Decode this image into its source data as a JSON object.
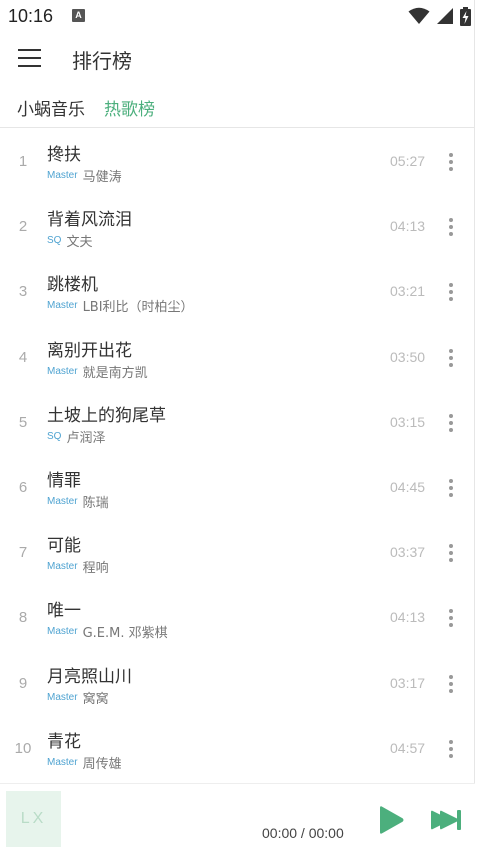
{
  "status_bar": {
    "time": "10:16",
    "notification_badge": "A",
    "icons": [
      "wifi-icon",
      "signal-icon",
      "battery-charging-icon"
    ]
  },
  "header": {
    "title": "排行榜",
    "menu_icon": "hamburger-menu-icon"
  },
  "tabs": {
    "source": "小蜗音乐",
    "board": "热歌榜",
    "active_color": "#4caf7d"
  },
  "songs": [
    {
      "index": "1",
      "name": "搀扶",
      "quality": "Master",
      "singer": "马健涛",
      "duration": "05:27"
    },
    {
      "index": "2",
      "name": "背着风流泪",
      "quality": "SQ",
      "singer": "文夫",
      "duration": "04:13"
    },
    {
      "index": "3",
      "name": "跳楼机",
      "quality": "Master",
      "singer": "LBI利比（时柏尘）",
      "duration": "03:21"
    },
    {
      "index": "4",
      "name": "离别开出花",
      "quality": "Master",
      "singer": "就是南方凯",
      "duration": "03:50"
    },
    {
      "index": "5",
      "name": "土坡上的狗尾草",
      "quality": "SQ",
      "singer": "卢润泽",
      "duration": "03:15"
    },
    {
      "index": "6",
      "name": "情罪",
      "quality": "Master",
      "singer": "陈瑞",
      "duration": "04:45"
    },
    {
      "index": "7",
      "name": "可能",
      "quality": "Master",
      "singer": "程响",
      "duration": "03:37"
    },
    {
      "index": "8",
      "name": "唯一",
      "quality": "Master",
      "singer": "G.E.M. 邓紫棋",
      "duration": "04:13"
    },
    {
      "index": "9",
      "name": "月亮照山川",
      "quality": "Master",
      "singer": "窝窝",
      "duration": "03:17"
    },
    {
      "index": "10",
      "name": "青花",
      "quality": "Master",
      "singer": "周传雄",
      "duration": "04:57"
    }
  ],
  "player": {
    "cover_text": "LX",
    "time": "00:00 / 00:00",
    "accent_color": "#4caf7d",
    "play_icon": "play-icon",
    "next_icon": "skip-next-icon"
  }
}
